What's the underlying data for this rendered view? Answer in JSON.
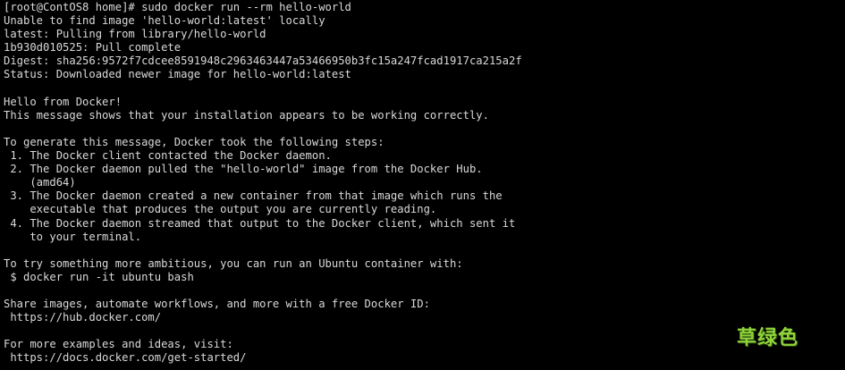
{
  "terminal": {
    "lines": [
      "[root@ContOS8 home]# sudo docker run --rm hello-world",
      "Unable to find image 'hello-world:latest' locally",
      "latest: Pulling from library/hello-world",
      "1b930d010525: Pull complete",
      "Digest: sha256:9572f7cdcee8591948c2963463447a53466950b3fc15a247fcad1917ca215a2f",
      "Status: Downloaded newer image for hello-world:latest",
      "",
      "Hello from Docker!",
      "This message shows that your installation appears to be working correctly.",
      "",
      "To generate this message, Docker took the following steps:",
      " 1. The Docker client contacted the Docker daemon.",
      " 2. The Docker daemon pulled the \"hello-world\" image from the Docker Hub.",
      "    (amd64)",
      " 3. The Docker daemon created a new container from that image which runs the",
      "    executable that produces the output you are currently reading.",
      " 4. The Docker daemon streamed that output to the Docker client, which sent it",
      "    to your terminal.",
      "",
      "To try something more ambitious, you can run an Ubuntu container with:",
      " $ docker run -it ubuntu bash",
      "",
      "Share images, automate workflows, and more with a free Docker ID:",
      " https://hub.docker.com/",
      "",
      "For more examples and ideas, visit:",
      " https://docs.docker.com/get-started/"
    ]
  },
  "watermark": {
    "text": "草绿色"
  },
  "colors": {
    "background": "#000000",
    "text": "#d9d9d9",
    "watermark": "#8fd43a"
  }
}
